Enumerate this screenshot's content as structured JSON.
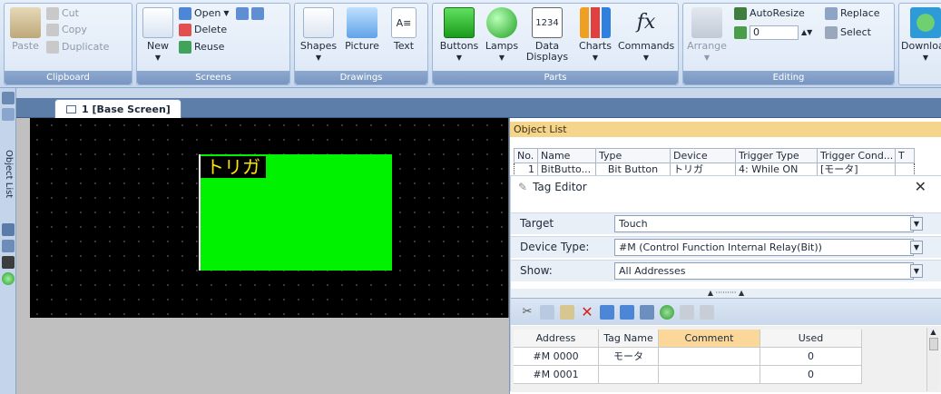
{
  "ribbon": {
    "clipboard": {
      "label": "Clipboard",
      "paste": "Paste",
      "cut": "Cut",
      "copy": "Copy",
      "duplicate": "Duplicate"
    },
    "screens": {
      "label": "Screens",
      "new": "New",
      "open": "Open",
      "delete": "Delete",
      "reuse": "Reuse"
    },
    "drawings": {
      "label": "Drawings",
      "shapes": "Shapes",
      "picture": "Picture",
      "text": "Text"
    },
    "parts": {
      "label": "Parts",
      "buttons": "Buttons",
      "lamps": "Lamps",
      "data_displays": "Data Displays",
      "charts": "Charts",
      "commands": "Commands",
      "data_icon_text": "1234"
    },
    "editing": {
      "label": "Editing",
      "arrange": "Arrange",
      "autoresize": "AutoResize",
      "replace": "Replace",
      "select": "Select",
      "spin_value": "0"
    },
    "download": "Download"
  },
  "left_toolbar": {
    "object_list": "Object List"
  },
  "tabs": [
    {
      "label": "1  [Base Screen]"
    }
  ],
  "canvas": {
    "bit_button_label": "トリガ",
    "bit_button_color": "#00f200",
    "label_color": "#ffe400"
  },
  "object_list": {
    "title": "Object List",
    "columns": [
      "No.",
      "Name",
      "Type",
      "Device",
      "Trigger Type",
      "Trigger Cond...",
      "T"
    ],
    "rows": [
      [
        "1",
        "BitButto...",
        "Bit Button",
        "トリガ",
        "4: While ON",
        "[モータ]",
        ""
      ]
    ]
  },
  "tag_editor": {
    "title": "Tag Editor",
    "target_label": "Target",
    "target_value": "Touch",
    "device_type_label": "Device Type:",
    "device_type_value": "#M (Control Function Internal Relay(Bit))",
    "show_label": "Show:",
    "show_value": "All Addresses",
    "columns": [
      "Address",
      "Tag Name",
      "Comment",
      "Used"
    ],
    "rows": [
      [
        "#M 0000",
        "モータ",
        "",
        "0"
      ],
      [
        "#M 0001",
        "",
        "",
        "0"
      ]
    ]
  }
}
